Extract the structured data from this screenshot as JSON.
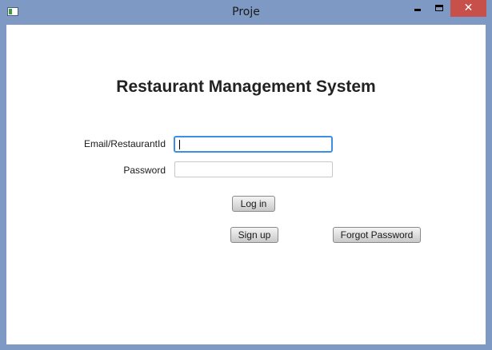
{
  "window": {
    "title": "Proje",
    "close_glyph": "✕",
    "icons": {
      "app": "app-window-icon",
      "minimize": "minimize-icon",
      "maximize": "maximize-icon",
      "close": "close-icon"
    },
    "colors": {
      "frame": "#7e99c4",
      "close": "#c7504b",
      "focus": "#3d8ee6"
    }
  },
  "form": {
    "heading": "Restaurant Management System",
    "email_label": "Email/RestaurantId",
    "email_value": "",
    "password_label": "Password",
    "password_value": "",
    "login_label": "Log in",
    "signup_label": "Sign up",
    "forgot_label": "Forgot Password"
  }
}
